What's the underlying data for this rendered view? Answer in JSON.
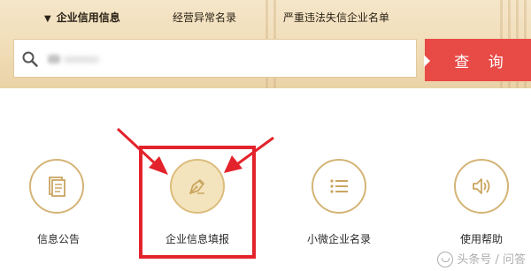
{
  "tabs": [
    {
      "label": "企业信用信息",
      "active": true
    },
    {
      "label": "经营异常名录",
      "active": false
    },
    {
      "label": "严重违法失信企业名单",
      "active": false
    }
  ],
  "search": {
    "value": "",
    "button_label": "查 询",
    "icon": "search-icon"
  },
  "features": [
    {
      "label": "信息公告",
      "icon": "document-icon"
    },
    {
      "label": "企业信息填报",
      "icon": "pen-nib-icon",
      "highlighted": true
    },
    {
      "label": "小微企业名录",
      "icon": "list-icon"
    },
    {
      "label": "使用帮助",
      "icon": "speaker-icon"
    }
  ],
  "annotations": {
    "highlight_color": "#e3232c",
    "arrows": 2
  },
  "watermark": {
    "text": "头条号 / 问答",
    "logo": "smile-logo"
  },
  "colors": {
    "accent": "#e84a46",
    "gold": "#d4b476",
    "banner": "#f0dcb6"
  }
}
